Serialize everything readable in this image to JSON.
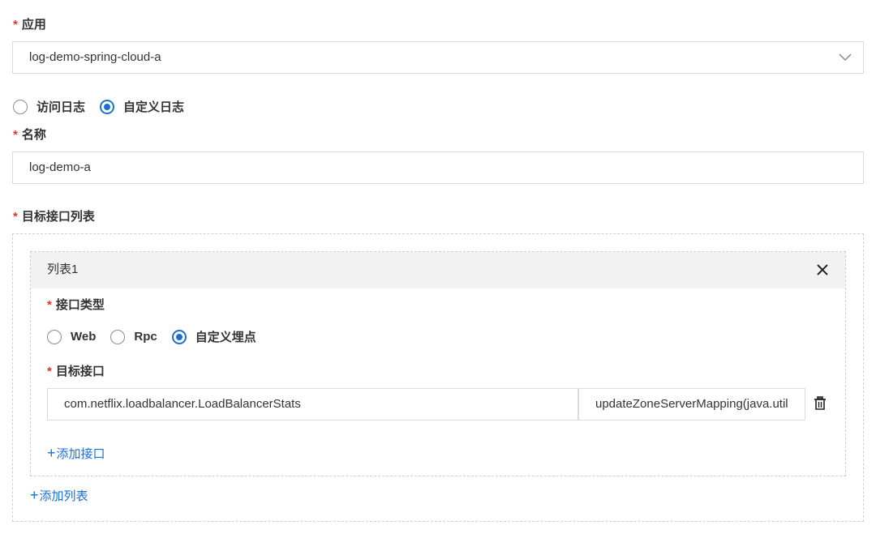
{
  "app": {
    "label": "应用",
    "value": "log-demo-spring-cloud-a"
  },
  "log_type": {
    "options": [
      "访问日志",
      "自定义日志"
    ],
    "selected": "自定义日志"
  },
  "name": {
    "label": "名称",
    "value": "log-demo-a"
  },
  "target_list": {
    "label": "目标接口列表",
    "lists": [
      {
        "title": "列表1",
        "interface_type": {
          "label": "接口类型",
          "options": [
            "Web",
            "Rpc",
            "自定义埋点"
          ],
          "selected": "自定义埋点"
        },
        "target_interface": {
          "label": "目标接口",
          "class_value": "com.netflix.loadbalancer.LoadBalancerStats",
          "method_value": "updateZoneServerMapping(java.util"
        },
        "add_interface_label": "添加接口"
      }
    ],
    "add_list_label": "添加列表"
  },
  "colors": {
    "accent": "#1a6fd6",
    "required": "#e5322d",
    "border": "#dcdcdc",
    "header_bg": "#f2f2f2"
  }
}
